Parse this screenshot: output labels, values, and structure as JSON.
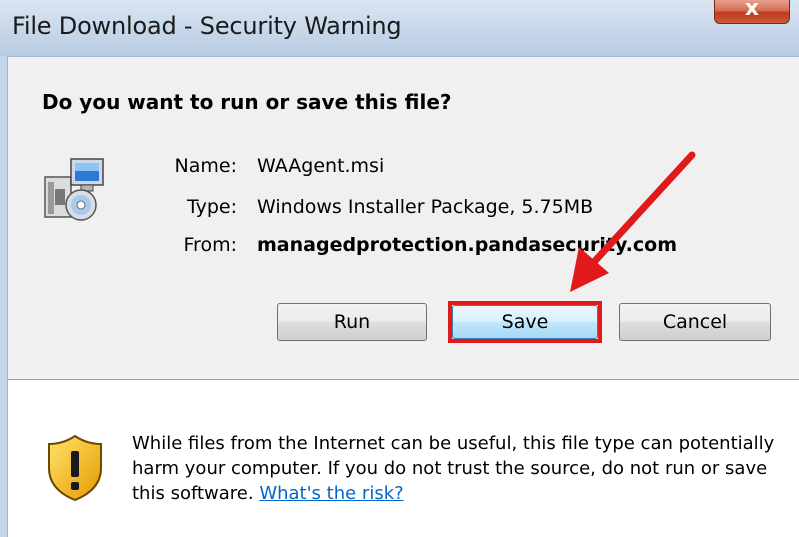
{
  "window": {
    "title": "File Download - Security Warning",
    "close_label": "x"
  },
  "dialog": {
    "question": "Do you want to run or save this file?",
    "file": {
      "name_label": "Name:",
      "name_value": "WAAgent.msi",
      "type_label": "Type:",
      "type_value": "Windows Installer Package, 5.75MB",
      "from_label": "From:",
      "from_value": "managedprotection.pandasecurity.com"
    },
    "buttons": {
      "run": "Run",
      "save": "Save",
      "cancel": "Cancel"
    }
  },
  "warning": {
    "text": "While files from the Internet can be useful, this file type can potentially harm your computer. If you do not trust the source, do not run or save this software. ",
    "link": "What's the risk?"
  },
  "icons": {
    "file": "installer-package-icon",
    "shield": "security-shield-icon",
    "annotation": "red-arrow"
  },
  "colors": {
    "highlight": "#e01a1a",
    "link": "#0066cc"
  }
}
